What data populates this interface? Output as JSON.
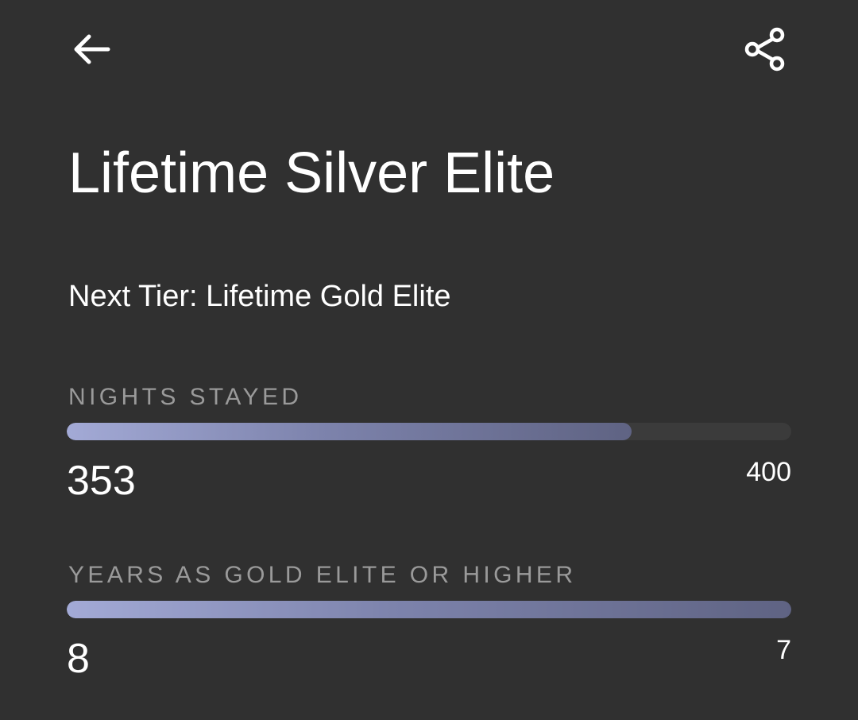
{
  "header": {
    "back_icon": "arrow-left-icon",
    "share_icon": "share-icon"
  },
  "title": "Lifetime Silver Elite",
  "next_tier": "Next Tier: Lifetime Gold Elite",
  "metrics": [
    {
      "label": "NIGHTS STAYED",
      "current": "353",
      "target": "400",
      "progress": 0.7797
    },
    {
      "label": "YEARS AS GOLD ELITE OR HIGHER",
      "current": "8",
      "target": "7",
      "progress": 1.0
    }
  ],
  "colors": {
    "background": "#303030",
    "text": "#ffffff",
    "label": "#9a9a9a",
    "track": "#3b3b3b",
    "fill_start": "#a3aad6",
    "fill_end": "#5f6383"
  }
}
